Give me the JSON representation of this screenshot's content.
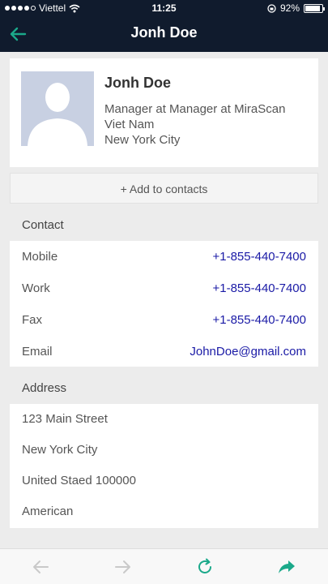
{
  "status_bar": {
    "carrier": "Viettel",
    "time": "11:25",
    "battery": "92%",
    "battery_level": 0.92
  },
  "nav": {
    "title": "Jonh Doe"
  },
  "profile": {
    "name": "Jonh Doe",
    "title": "Manager at Manager at MiraScan",
    "country": "Viet Nam",
    "city": "New York City"
  },
  "actions": {
    "add_contact": "+ Add to contacts"
  },
  "contact": {
    "header": "Contact",
    "rows": [
      {
        "label": "Mobile",
        "value": "+1-855-440-7400"
      },
      {
        "label": "Work",
        "value": "+1-855-440-7400"
      },
      {
        "label": "Fax",
        "value": "+1-855-440-7400"
      },
      {
        "label": "Email",
        "value": "JohnDoe@gmail.com"
      }
    ]
  },
  "address": {
    "header": "Address",
    "lines": [
      "123 Main Street",
      "New York City",
      "United Staed 100000",
      "American"
    ]
  },
  "colors": {
    "nav_bg": "#101b2d",
    "accent": "#1ba98a",
    "link": "#1a1aa6"
  },
  "icons": [
    "back-arrow-icon",
    "wifi-icon",
    "battery-icon",
    "browser-back-icon",
    "browser-forward-icon",
    "refresh-icon",
    "share-icon"
  ]
}
